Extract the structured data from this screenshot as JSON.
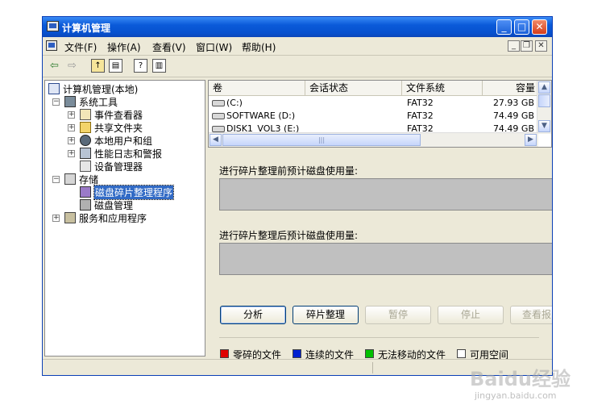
{
  "window": {
    "title": "计算机管理",
    "controls": {
      "minimize": "_",
      "maximize": "□",
      "close": "✕"
    }
  },
  "menubar": {
    "items": [
      "文件(F)",
      "操作(A)",
      "查看(V)",
      "窗口(W)",
      "帮助(H)"
    ],
    "mdi": {
      "minimize": "_",
      "restore": "❐",
      "close": "✕"
    }
  },
  "toolbar": {
    "icons": [
      "back-arrow-icon",
      "forward-arrow-icon",
      "up-folder-icon",
      "show-hide-tree-icon",
      "help-icon",
      "properties-icon"
    ]
  },
  "tree": {
    "root": "计算机管理(本地)",
    "items": [
      {
        "label": "系统工具",
        "level": 1,
        "expander": "−"
      },
      {
        "label": "事件查看器",
        "level": 2,
        "expander": "+"
      },
      {
        "label": "共享文件夹",
        "level": 2,
        "expander": "+"
      },
      {
        "label": "本地用户和组",
        "level": 2,
        "expander": "+"
      },
      {
        "label": "性能日志和警报",
        "level": 2,
        "expander": "+"
      },
      {
        "label": "设备管理器",
        "level": 2,
        "expander": ""
      },
      {
        "label": "存储",
        "level": 1,
        "expander": "−"
      },
      {
        "label": "磁盘碎片整理程序",
        "level": 2,
        "expander": "",
        "selected": true
      },
      {
        "label": "磁盘管理",
        "level": 2,
        "expander": ""
      },
      {
        "label": "服务和应用程序",
        "level": 1,
        "expander": "+"
      }
    ]
  },
  "volumes": {
    "columns": [
      "卷",
      "会话状态",
      "文件系统",
      "容量"
    ],
    "rows": [
      {
        "volume": "(C:)",
        "status": "",
        "fs": "FAT32",
        "capacity": "27.93 GB"
      },
      {
        "volume": "SOFTWARE (D:)",
        "status": "",
        "fs": "FAT32",
        "capacity": "74.49 GB"
      },
      {
        "volume": "DISK1_VOL3 (E:)",
        "status": "",
        "fs": "FAT32",
        "capacity": "74.49 GB"
      }
    ]
  },
  "defrag": {
    "before_label": "进行碎片整理前预计磁盘使用量:",
    "after_label": "进行碎片整理后预计磁盘使用量:",
    "buttons": {
      "analyze": "分析",
      "defragment": "碎片整理",
      "pause": "暂停",
      "stop": "停止",
      "view_report": "查看报"
    },
    "legend": [
      {
        "label": "零碎的文件",
        "color": "#e00000"
      },
      {
        "label": "连续的文件",
        "color": "#0020d0"
      },
      {
        "label": "无法移动的文件",
        "color": "#00c000"
      },
      {
        "label": "可用空间",
        "color": "#ffffff"
      }
    ]
  },
  "watermark": {
    "brand": "Baidu经验",
    "url": "jingyan.baidu.com"
  }
}
